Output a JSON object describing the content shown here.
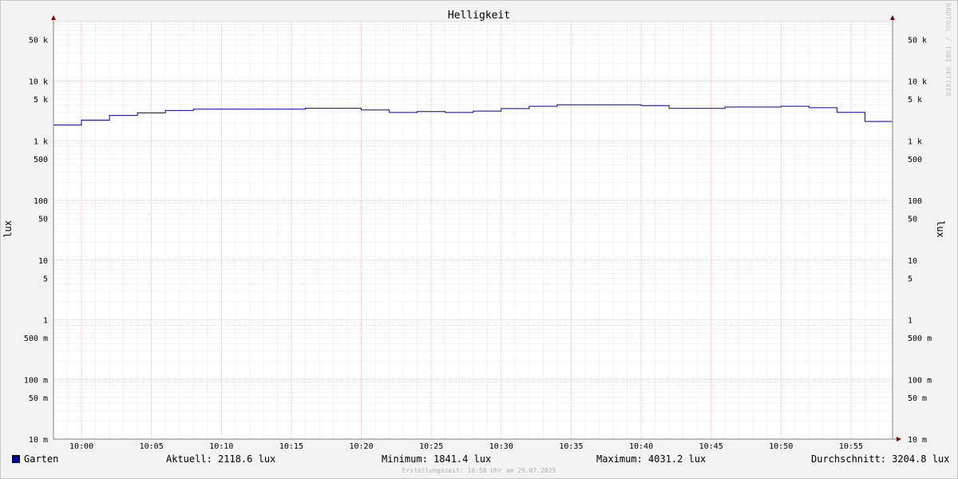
{
  "chart_data": {
    "type": "line",
    "title": "Helligkeit",
    "ylabel": "lux",
    "yscale": "log",
    "ylim": [
      0.01,
      100000
    ],
    "xlim": [
      "09:58",
      "11:58"
    ],
    "x_ticks": [
      "10:00",
      "10:05",
      "10:10",
      "10:15",
      "10:20",
      "10:25",
      "10:30",
      "10:35",
      "10:40",
      "10:45",
      "10:50",
      "10:55"
    ],
    "y_ticks": [
      {
        "value": 50000,
        "label": "50 k"
      },
      {
        "value": 10000,
        "label": "10 k"
      },
      {
        "value": 5000,
        "label": "5 k"
      },
      {
        "value": 1000,
        "label": "1 k"
      },
      {
        "value": 500,
        "label": "500"
      },
      {
        "value": 100,
        "label": "100"
      },
      {
        "value": 50,
        "label": "50"
      },
      {
        "value": 10,
        "label": "10"
      },
      {
        "value": 5,
        "label": "5"
      },
      {
        "value": 1,
        "label": "1"
      },
      {
        "value": 0.5,
        "label": "500 m"
      },
      {
        "value": 0.1,
        "label": "100 m"
      },
      {
        "value": 0.05,
        "label": "50 m"
      },
      {
        "value": 0.01,
        "label": "10 m"
      }
    ],
    "grid": true,
    "legend_position": "bottom",
    "series": [
      {
        "name": "Garten",
        "color": "#0000a0",
        "points": [
          [
            "09:58",
            1841.4
          ],
          [
            "10:00",
            2220
          ],
          [
            "10:02",
            2660
          ],
          [
            "10:04",
            2950
          ],
          [
            "10:06",
            3230
          ],
          [
            "10:08",
            3400
          ],
          [
            "10:10",
            3400
          ],
          [
            "10:12",
            3400
          ],
          [
            "10:14",
            3400
          ],
          [
            "10:16",
            3510
          ],
          [
            "10:18",
            3510
          ],
          [
            "10:20",
            3300
          ],
          [
            "10:22",
            2990
          ],
          [
            "10:24",
            3100
          ],
          [
            "10:26",
            2990
          ],
          [
            "10:28",
            3160
          ],
          [
            "10:30",
            3470
          ],
          [
            "10:32",
            3800
          ],
          [
            "10:34",
            4031.2
          ],
          [
            "10:36",
            4031.2
          ],
          [
            "10:38",
            4031.2
          ],
          [
            "10:40",
            3900
          ],
          [
            "10:42",
            3500
          ],
          [
            "10:44",
            3500
          ],
          [
            "10:46",
            3700
          ],
          [
            "10:48",
            3700
          ],
          [
            "10:50",
            3800
          ],
          [
            "10:52",
            3600
          ],
          [
            "10:54",
            3000
          ],
          [
            "10:56",
            2118.6
          ],
          [
            "10:58",
            2118.6
          ]
        ]
      }
    ]
  },
  "legend": {
    "series_name": "Garten",
    "aktuell": "Aktuell: 2118.6 lux",
    "minimum": "Minimum: 1841.4 lux",
    "maximum": "Maximum: 4031.2 lux",
    "durchschnitt": "Durchschnitt: 3204.8 lux"
  },
  "footer": "Erstellungszeit: 10:58 Uhr am 29.07.2025",
  "watermark": "RRDTOOL / TOBI OETIKER",
  "colors": {
    "line": "#0000a0",
    "grid_major": "#f0a0a0",
    "grid_minor": "#d8d8d8",
    "background": "#f3f3f3",
    "plot_bg": "#ffffff",
    "axis": "#808080",
    "arrow": "#800000"
  }
}
